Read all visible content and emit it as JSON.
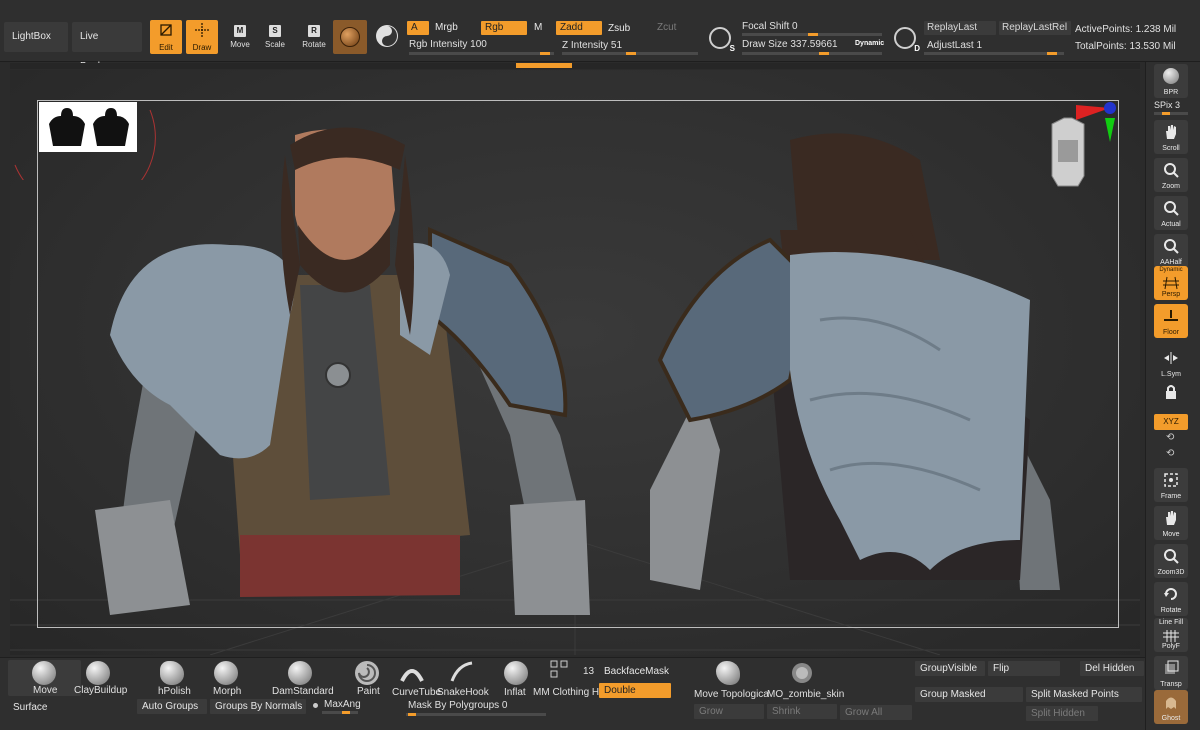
{
  "top": {
    "lightbox": "LightBox",
    "live_boolean": "Live Boolean",
    "edit": "Edit",
    "draw": "Draw",
    "move": "Move",
    "scale": "Scale",
    "rotate": "Rotate",
    "key_move": "M",
    "key_scale": "S",
    "key_rotate": "R",
    "a": "A",
    "mrgb": "Mrgb",
    "rgb": "Rgb",
    "m": "M",
    "rgb_intensity": "Rgb Intensity 100",
    "zadd": "Zadd",
    "zsub": "Zsub",
    "zcut": "Zcut",
    "z_intensity": "Z Intensity 51",
    "focal_shift": "Focal Shift 0",
    "draw_size": "Draw Size 337.59661",
    "dynamic": "Dynamic",
    "replay_last": "ReplayLast",
    "replay_last_rel": "ReplayLastRel",
    "adjust_last": "AdjustLast 1",
    "active_points": "ActivePoints: 1.238 Mil",
    "total_points": "TotalPoints: 13.530 Mil",
    "s_letter": "S",
    "d_letter": "D",
    "rgb_intensity_level": 1.0,
    "z_intensity_level": 0.51
  },
  "right_shelf": {
    "bpr": "BPR",
    "spix": "SPix 3",
    "scroll": "Scroll",
    "zoom": "Zoom",
    "actual": "Actual",
    "aahalf": "AAHalf",
    "dynamic": "Dynamic",
    "persp": "Persp",
    "floor": "Floor",
    "lsym": "L.Sym",
    "xyz": "XYZ",
    "frame": "Frame",
    "move": "Move",
    "zoom3d": "Zoom3D",
    "rotate": "Rotate",
    "linefill": "Line Fill",
    "polyf": "PolyF",
    "transp": "Transp",
    "ghost": "Ghost"
  },
  "bottom": {
    "brushes": [
      "Move",
      "ClayBuildup",
      "hPolish",
      "Morph",
      "DamStandard",
      "Paint",
      "CurveTube",
      "SnakeHook",
      "Inflat",
      "MM Clothing Ha"
    ],
    "count": "13",
    "backface_mask": "BackfaceMask",
    "double": "Double",
    "move_topological": "Move Topologica",
    "mo_zombie_skin": "MO_zombie_skin",
    "surface": "Surface",
    "auto_groups": "Auto Groups",
    "groups_by_normals": "Groups By Normals",
    "max_angle": "MaxAng",
    "mask_by_polygroups": "Mask By Polygroups 0",
    "grow": "Grow",
    "shrink": "Shrink",
    "grow_all": "Grow All",
    "group_visible": "GroupVisible",
    "flip": "Flip",
    "del_hidden": "Del Hidden",
    "group_masked": "Group Masked",
    "split_masked_points": "Split Masked Points",
    "split_hidden": "Split Hidden"
  },
  "colors": {
    "accent": "#f39c2b",
    "panel": "#2f2f2f",
    "button": "#3a3a3a"
  }
}
